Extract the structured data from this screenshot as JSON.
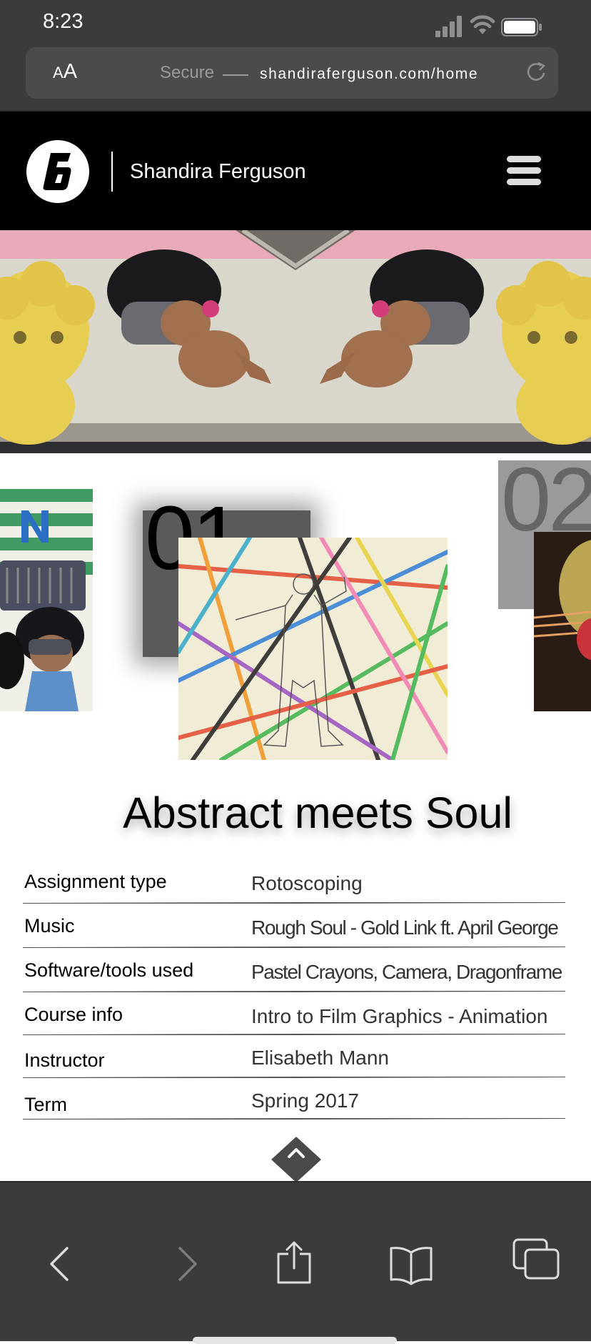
{
  "status_bar": {
    "time": "8:23"
  },
  "browser": {
    "text_size_label_small": "A",
    "text_size_label_large": "A",
    "secure_label": "Secure",
    "url": "shandiraferguson.com/home"
  },
  "site": {
    "name": "Shandira Ferguson",
    "logo_glyph": "6"
  },
  "gallery": {
    "current_number": "01",
    "next_number": "02",
    "project_title": "Abstract meets Soul"
  },
  "details": [
    {
      "label": "Assignment type",
      "value": "Rotoscoping"
    },
    {
      "label": "Music",
      "value": "Rough Soul - Gold Link ft. April George"
    },
    {
      "label": "Software/tools used",
      "value": "Pastel Crayons, Camera, Dragonframe"
    },
    {
      "label": "Course info",
      "value": "Intro to Film Graphics - Animation"
    },
    {
      "label": "Instructor",
      "value": "Elisabeth Mann"
    },
    {
      "label": "Term",
      "value": "Spring 2017"
    }
  ],
  "icons": [
    "back-icon",
    "forward-icon",
    "share-icon",
    "bookmarks-icon",
    "tabs-icon",
    "menu-icon",
    "reload-icon",
    "chevron-up-icon"
  ],
  "colors": {
    "chrome": "#3b3b3d",
    "header": "#000000",
    "accent_pink": "#e8a9b8"
  }
}
